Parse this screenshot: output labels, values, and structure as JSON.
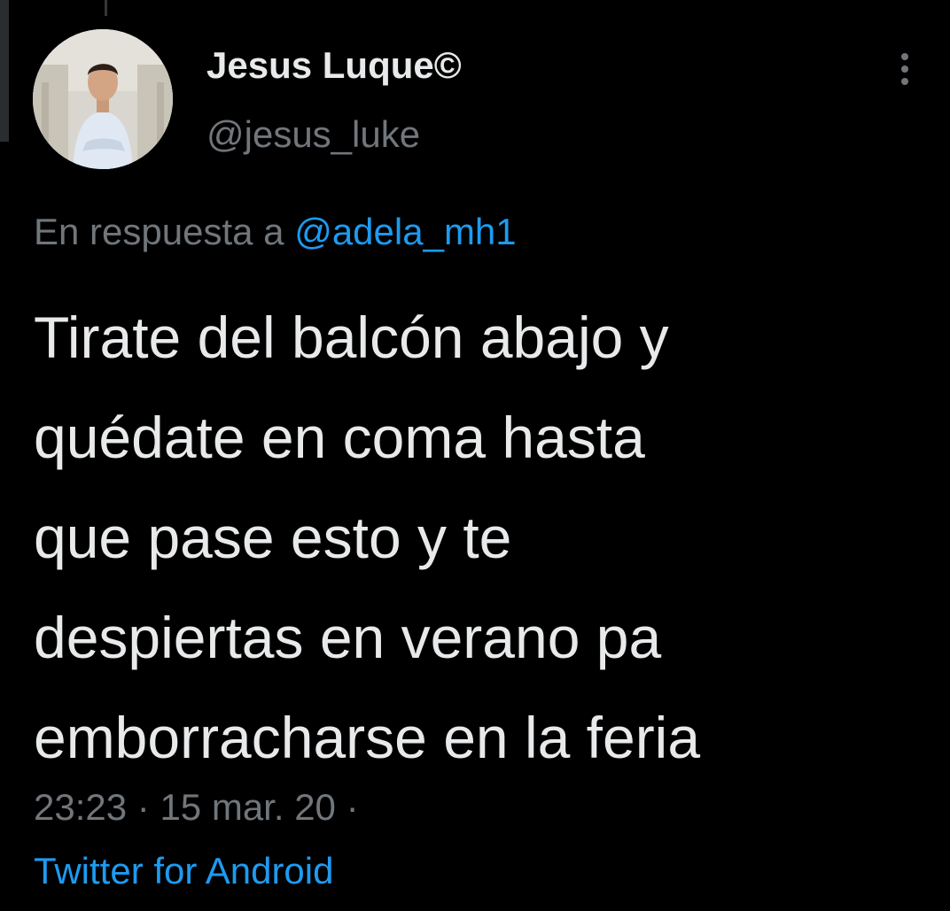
{
  "tweet": {
    "author": {
      "display_name": "Jesus Luque©",
      "handle": "@jesus_luke",
      "avatar_icon": "profile-photo"
    },
    "reply_to": {
      "prefix": "En respuesta a",
      "mention": "@adela_mh1"
    },
    "text_lines": [
      "Tirate del balcón abajo y",
      "quédate en coma hasta",
      "que pase esto y te",
      "despiertas en verano pa",
      "emborracharse en la feria"
    ],
    "timestamp": {
      "time": "23:23",
      "separator": "·",
      "date": "15 mar. 20",
      "trailing_separator": "·"
    },
    "source": "Twitter for Android",
    "more_icon": "more-vertical-icon"
  },
  "colors": {
    "background": "#000000",
    "primary_text": "#e7e9ea",
    "secondary_text": "#71767b",
    "link": "#1d9bf0"
  }
}
